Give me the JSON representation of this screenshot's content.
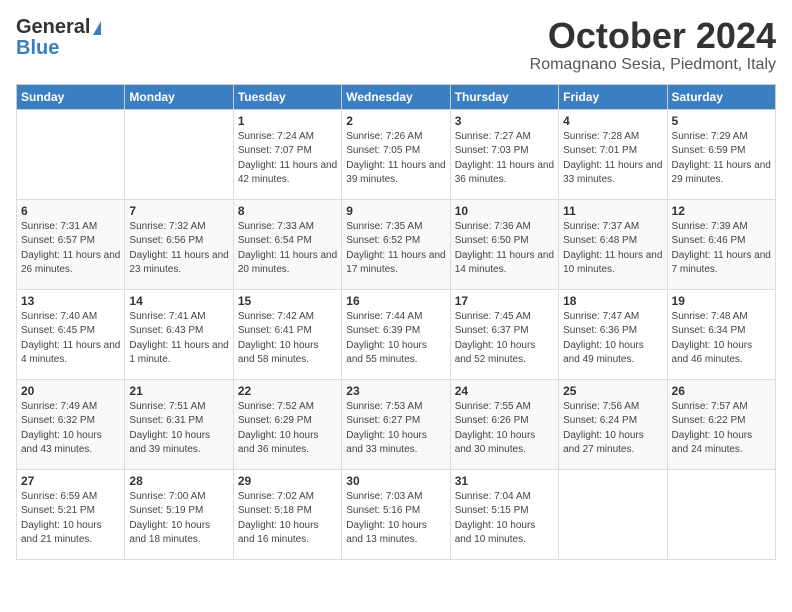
{
  "header": {
    "logo_line1": "General",
    "logo_line2": "Blue",
    "month": "October 2024",
    "location": "Romagnano Sesia, Piedmont, Italy"
  },
  "weekdays": [
    "Sunday",
    "Monday",
    "Tuesday",
    "Wednesday",
    "Thursday",
    "Friday",
    "Saturday"
  ],
  "weeks": [
    [
      {
        "day": "",
        "sunrise": "",
        "sunset": "",
        "daylight": ""
      },
      {
        "day": "",
        "sunrise": "",
        "sunset": "",
        "daylight": ""
      },
      {
        "day": "1",
        "sunrise": "Sunrise: 7:24 AM",
        "sunset": "Sunset: 7:07 PM",
        "daylight": "Daylight: 11 hours and 42 minutes."
      },
      {
        "day": "2",
        "sunrise": "Sunrise: 7:26 AM",
        "sunset": "Sunset: 7:05 PM",
        "daylight": "Daylight: 11 hours and 39 minutes."
      },
      {
        "day": "3",
        "sunrise": "Sunrise: 7:27 AM",
        "sunset": "Sunset: 7:03 PM",
        "daylight": "Daylight: 11 hours and 36 minutes."
      },
      {
        "day": "4",
        "sunrise": "Sunrise: 7:28 AM",
        "sunset": "Sunset: 7:01 PM",
        "daylight": "Daylight: 11 hours and 33 minutes."
      },
      {
        "day": "5",
        "sunrise": "Sunrise: 7:29 AM",
        "sunset": "Sunset: 6:59 PM",
        "daylight": "Daylight: 11 hours and 29 minutes."
      }
    ],
    [
      {
        "day": "6",
        "sunrise": "Sunrise: 7:31 AM",
        "sunset": "Sunset: 6:57 PM",
        "daylight": "Daylight: 11 hours and 26 minutes."
      },
      {
        "day": "7",
        "sunrise": "Sunrise: 7:32 AM",
        "sunset": "Sunset: 6:56 PM",
        "daylight": "Daylight: 11 hours and 23 minutes."
      },
      {
        "day": "8",
        "sunrise": "Sunrise: 7:33 AM",
        "sunset": "Sunset: 6:54 PM",
        "daylight": "Daylight: 11 hours and 20 minutes."
      },
      {
        "day": "9",
        "sunrise": "Sunrise: 7:35 AM",
        "sunset": "Sunset: 6:52 PM",
        "daylight": "Daylight: 11 hours and 17 minutes."
      },
      {
        "day": "10",
        "sunrise": "Sunrise: 7:36 AM",
        "sunset": "Sunset: 6:50 PM",
        "daylight": "Daylight: 11 hours and 14 minutes."
      },
      {
        "day": "11",
        "sunrise": "Sunrise: 7:37 AM",
        "sunset": "Sunset: 6:48 PM",
        "daylight": "Daylight: 11 hours and 10 minutes."
      },
      {
        "day": "12",
        "sunrise": "Sunrise: 7:39 AM",
        "sunset": "Sunset: 6:46 PM",
        "daylight": "Daylight: 11 hours and 7 minutes."
      }
    ],
    [
      {
        "day": "13",
        "sunrise": "Sunrise: 7:40 AM",
        "sunset": "Sunset: 6:45 PM",
        "daylight": "Daylight: 11 hours and 4 minutes."
      },
      {
        "day": "14",
        "sunrise": "Sunrise: 7:41 AM",
        "sunset": "Sunset: 6:43 PM",
        "daylight": "Daylight: 11 hours and 1 minute."
      },
      {
        "day": "15",
        "sunrise": "Sunrise: 7:42 AM",
        "sunset": "Sunset: 6:41 PM",
        "daylight": "Daylight: 10 hours and 58 minutes."
      },
      {
        "day": "16",
        "sunrise": "Sunrise: 7:44 AM",
        "sunset": "Sunset: 6:39 PM",
        "daylight": "Daylight: 10 hours and 55 minutes."
      },
      {
        "day": "17",
        "sunrise": "Sunrise: 7:45 AM",
        "sunset": "Sunset: 6:37 PM",
        "daylight": "Daylight: 10 hours and 52 minutes."
      },
      {
        "day": "18",
        "sunrise": "Sunrise: 7:47 AM",
        "sunset": "Sunset: 6:36 PM",
        "daylight": "Daylight: 10 hours and 49 minutes."
      },
      {
        "day": "19",
        "sunrise": "Sunrise: 7:48 AM",
        "sunset": "Sunset: 6:34 PM",
        "daylight": "Daylight: 10 hours and 46 minutes."
      }
    ],
    [
      {
        "day": "20",
        "sunrise": "Sunrise: 7:49 AM",
        "sunset": "Sunset: 6:32 PM",
        "daylight": "Daylight: 10 hours and 43 minutes."
      },
      {
        "day": "21",
        "sunrise": "Sunrise: 7:51 AM",
        "sunset": "Sunset: 6:31 PM",
        "daylight": "Daylight: 10 hours and 39 minutes."
      },
      {
        "day": "22",
        "sunrise": "Sunrise: 7:52 AM",
        "sunset": "Sunset: 6:29 PM",
        "daylight": "Daylight: 10 hours and 36 minutes."
      },
      {
        "day": "23",
        "sunrise": "Sunrise: 7:53 AM",
        "sunset": "Sunset: 6:27 PM",
        "daylight": "Daylight: 10 hours and 33 minutes."
      },
      {
        "day": "24",
        "sunrise": "Sunrise: 7:55 AM",
        "sunset": "Sunset: 6:26 PM",
        "daylight": "Daylight: 10 hours and 30 minutes."
      },
      {
        "day": "25",
        "sunrise": "Sunrise: 7:56 AM",
        "sunset": "Sunset: 6:24 PM",
        "daylight": "Daylight: 10 hours and 27 minutes."
      },
      {
        "day": "26",
        "sunrise": "Sunrise: 7:57 AM",
        "sunset": "Sunset: 6:22 PM",
        "daylight": "Daylight: 10 hours and 24 minutes."
      }
    ],
    [
      {
        "day": "27",
        "sunrise": "Sunrise: 6:59 AM",
        "sunset": "Sunset: 5:21 PM",
        "daylight": "Daylight: 10 hours and 21 minutes."
      },
      {
        "day": "28",
        "sunrise": "Sunrise: 7:00 AM",
        "sunset": "Sunset: 5:19 PM",
        "daylight": "Daylight: 10 hours and 18 minutes."
      },
      {
        "day": "29",
        "sunrise": "Sunrise: 7:02 AM",
        "sunset": "Sunset: 5:18 PM",
        "daylight": "Daylight: 10 hours and 16 minutes."
      },
      {
        "day": "30",
        "sunrise": "Sunrise: 7:03 AM",
        "sunset": "Sunset: 5:16 PM",
        "daylight": "Daylight: 10 hours and 13 minutes."
      },
      {
        "day": "31",
        "sunrise": "Sunrise: 7:04 AM",
        "sunset": "Sunset: 5:15 PM",
        "daylight": "Daylight: 10 hours and 10 minutes."
      },
      {
        "day": "",
        "sunrise": "",
        "sunset": "",
        "daylight": ""
      },
      {
        "day": "",
        "sunrise": "",
        "sunset": "",
        "daylight": ""
      }
    ]
  ]
}
